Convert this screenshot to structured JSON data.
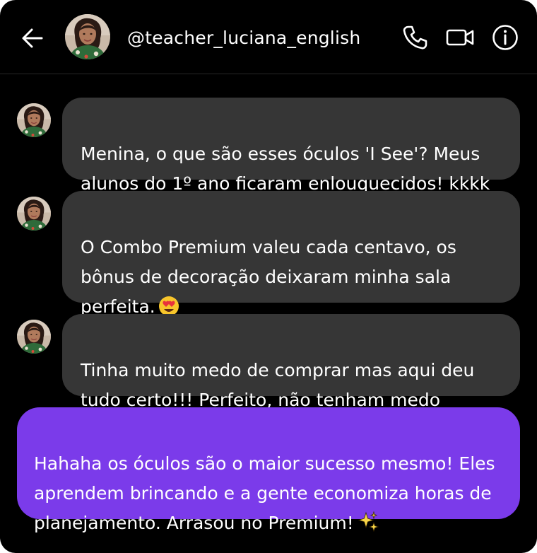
{
  "header": {
    "username": "@teacher_luciana_english",
    "icons": [
      "back-arrow-icon",
      "phone-icon",
      "video-camera-icon",
      "info-icon"
    ]
  },
  "messages": [
    {
      "sender": "incoming",
      "text": "Menina, o que são esses óculos 'I See'? Meus\nalunos do 1º ano ficaram enlouquecidos! kkkk"
    },
    {
      "sender": "incoming",
      "text": "O Combo Premium valeu cada centavo, os\nbônus de decoração deixaram minha sala\nperfeita.",
      "emoji": "heart-eyes-emoji"
    },
    {
      "sender": "incoming",
      "text": "Tinha muito medo de comprar mas aqui deu\ntudo certo!!! Perfeito, não tenham medo"
    },
    {
      "sender": "outgoing",
      "text": "Hahaha os óculos são o maior sucesso mesmo! Eles\naprendem brincando e a gente economiza horas de\nplanejamento. Arrasou no Premium!",
      "emoji": "sparkles-emoji"
    }
  ],
  "colors": {
    "background": "#000000",
    "incoming_bubble": "#363636",
    "outgoing_bubble": "#7b3bea",
    "text": "#ffffff"
  }
}
